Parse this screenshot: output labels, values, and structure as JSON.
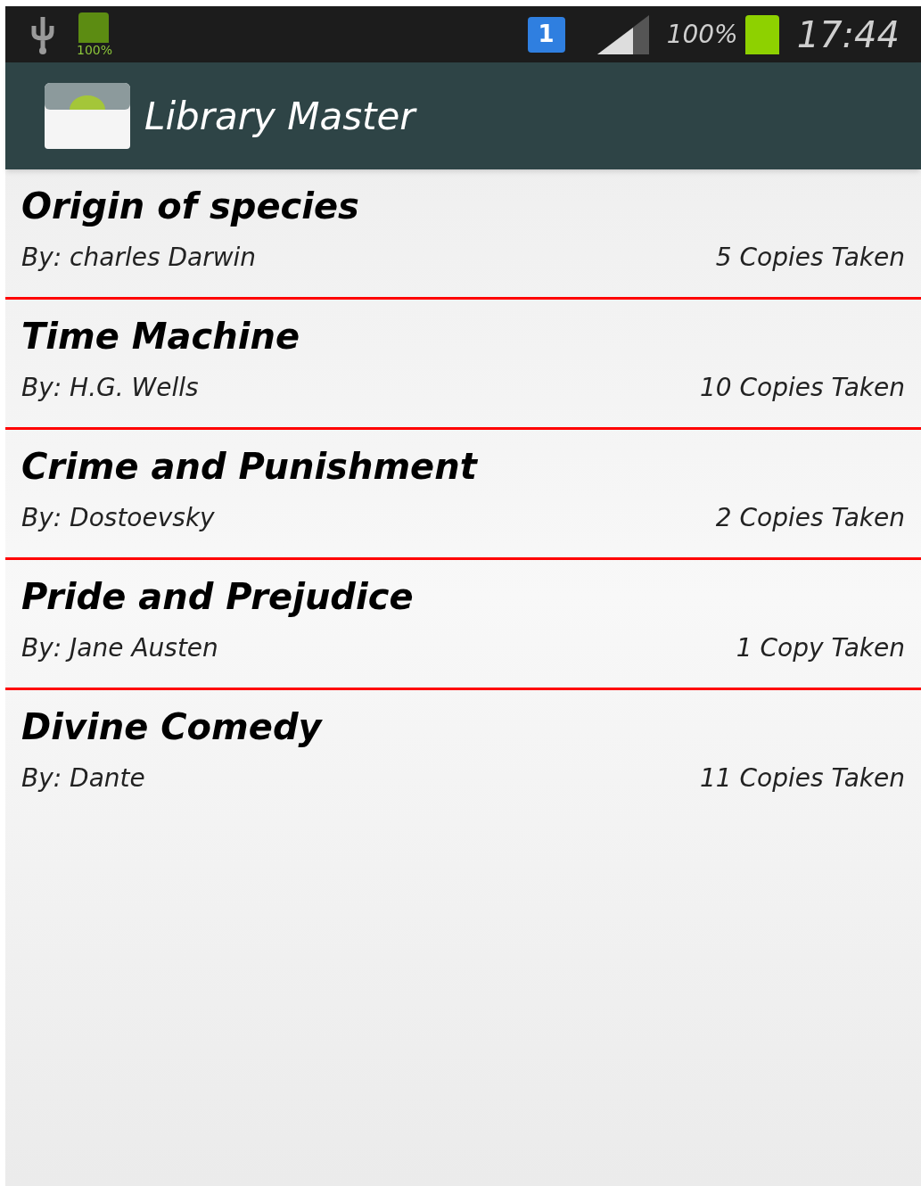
{
  "status_bar": {
    "battery_badge": "100%",
    "notification_count": "1",
    "battery_percent": "100%",
    "time": "17:44"
  },
  "action_bar": {
    "title": "Library Master"
  },
  "books": [
    {
      "title": "Origin of species",
      "author": "By: charles Darwin",
      "copies": "5 Copies Taken"
    },
    {
      "title": "Time Machine",
      "author": "By: H.G. Wells",
      "copies": "10 Copies Taken"
    },
    {
      "title": "Crime and Punishment",
      "author": "By: Dostoevsky",
      "copies": "2 Copies Taken"
    },
    {
      "title": "Pride and Prejudice",
      "author": "By: Jane Austen",
      "copies": "1 Copy Taken"
    },
    {
      "title": "Divine Comedy",
      "author": "By: Dante",
      "copies": "11 Copies Taken"
    }
  ]
}
